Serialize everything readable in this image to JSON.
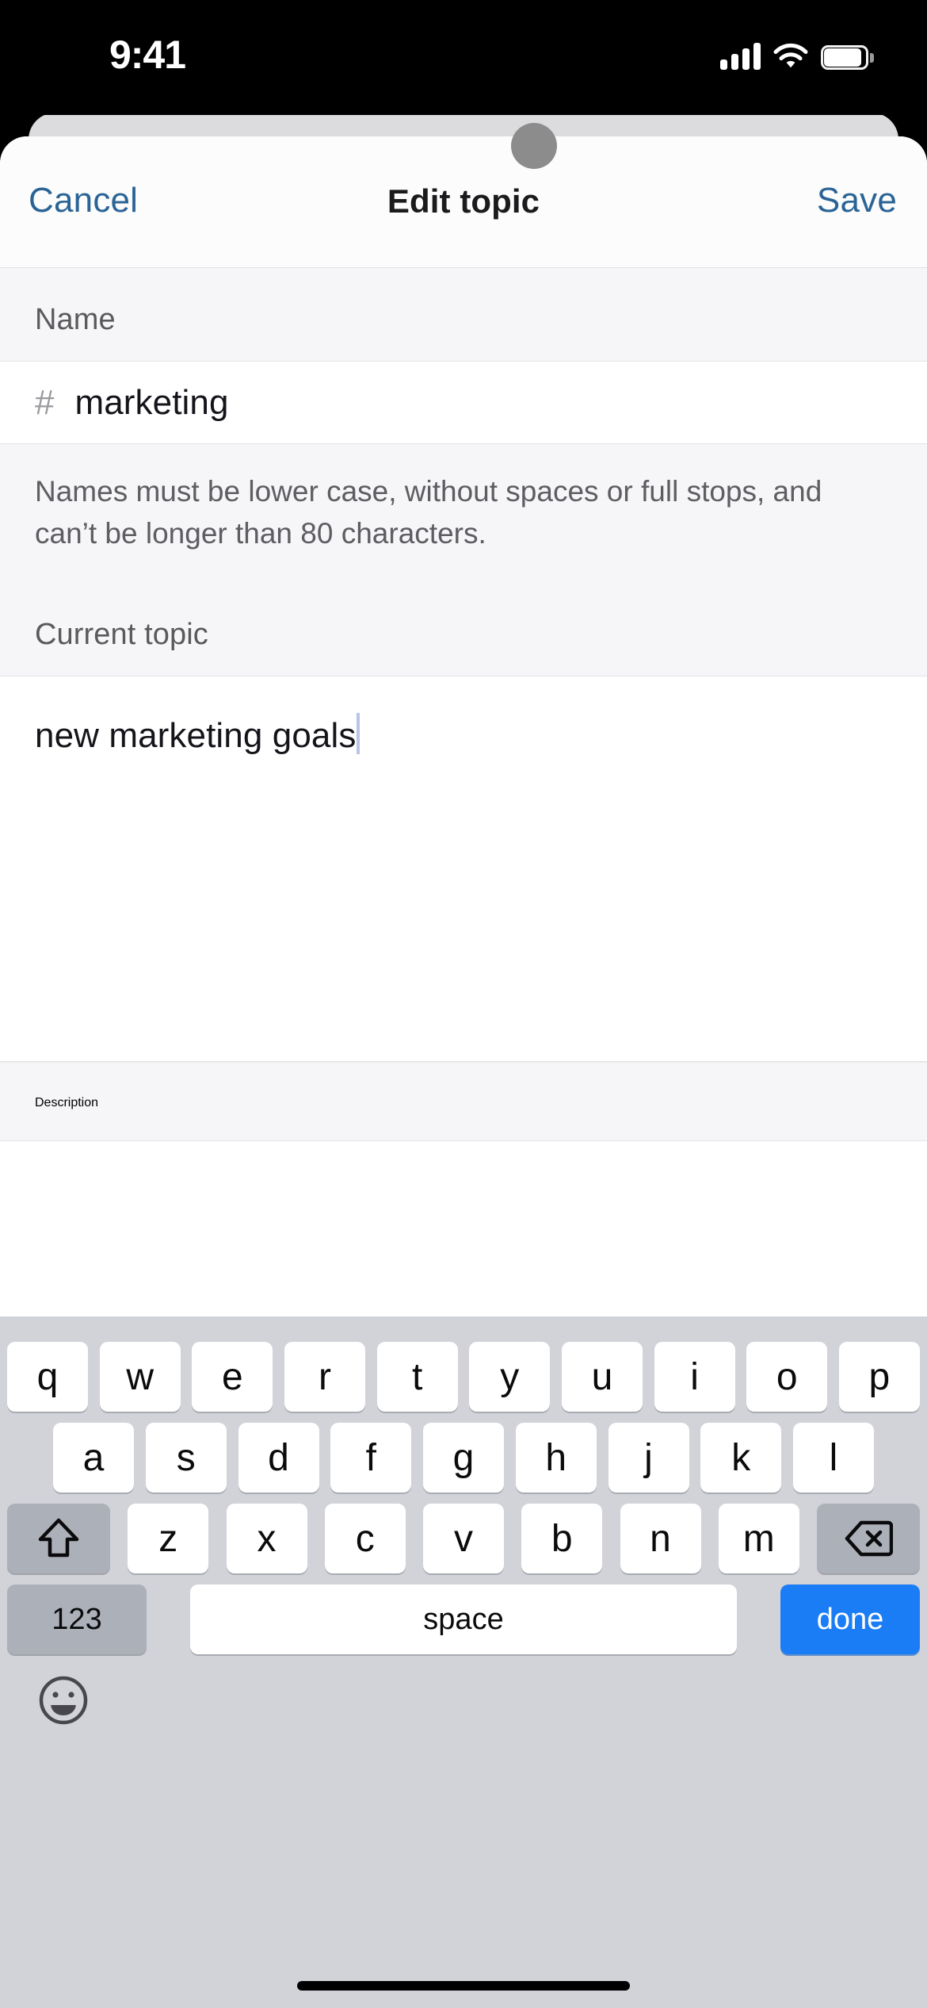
{
  "status_bar": {
    "time": "9:41",
    "signal_icon": "cellular-bars-icon",
    "wifi_icon": "wifi-icon",
    "battery_icon": "battery-icon"
  },
  "nav": {
    "cancel_label": "Cancel",
    "title": "Edit topic",
    "save_label": "Save",
    "link_color": "#2a6496"
  },
  "form": {
    "name_section_label": "Name",
    "name_prefix": "#",
    "name_value": "marketing",
    "name_helper_text": "Names must be lower case, without spaces or full stops, and can’t be longer than 80 characters.",
    "topic_section_label": "Current topic",
    "topic_value": "new marketing goals",
    "description_section_label": "Description"
  },
  "keyboard": {
    "row1": [
      "q",
      "w",
      "e",
      "r",
      "t",
      "y",
      "u",
      "i",
      "o",
      "p"
    ],
    "row2": [
      "a",
      "s",
      "d",
      "f",
      "g",
      "h",
      "j",
      "k",
      "l"
    ],
    "row3": [
      "z",
      "x",
      "c",
      "v",
      "b",
      "n",
      "m"
    ],
    "shift_icon": "shift-arrow-icon",
    "delete_icon": "backspace-delete-icon",
    "numeric_label": "123",
    "space_label": "space",
    "done_label": "done",
    "emoji_icon": "emoji-smiley-icon",
    "done_color": "#1a7df5",
    "background_color": "#d1d3d9"
  },
  "home_indicator": "home-indicator-bar"
}
